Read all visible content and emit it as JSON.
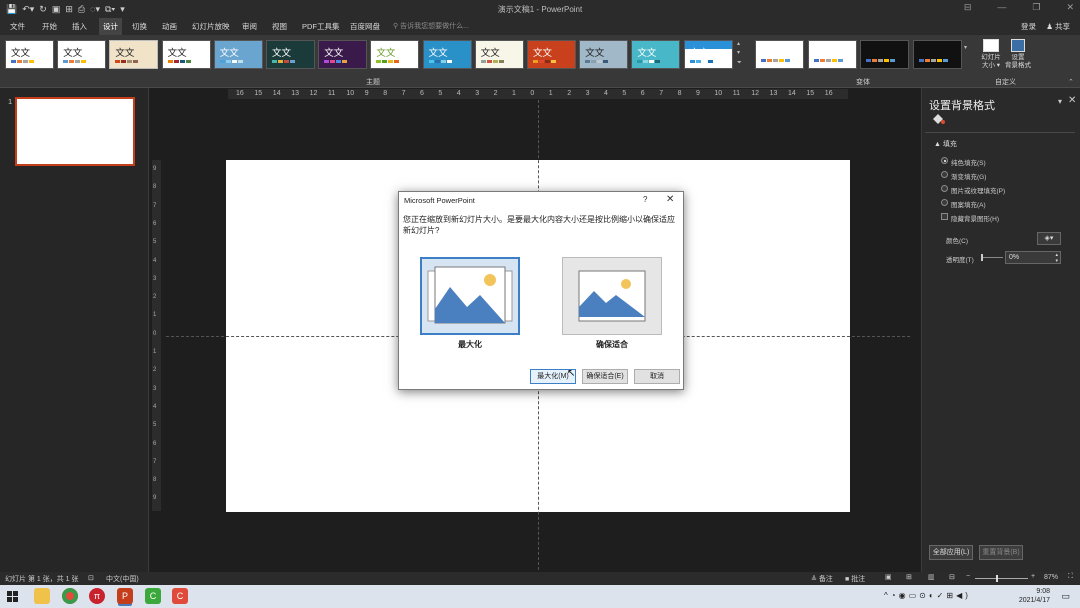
{
  "window": {
    "title": "演示文稿1 - PowerPoint"
  },
  "tabs": [
    "文件",
    "开始",
    "插入",
    "设计",
    "切换",
    "动画",
    "幻灯片放映",
    "审阅",
    "视图",
    "PDF工具集",
    "百度网盘"
  ],
  "active_tab": "设计",
  "tellme": "告诉我您想要做什么...",
  "account": {
    "login": "登录",
    "share": "共享"
  },
  "ribbon": {
    "themes_label": "主题",
    "variants_label": "变体",
    "custom_label": "自定义",
    "theme_thumb_text": "文文",
    "slide_size_label": "幻灯片\n大小 ▾",
    "format_bg_label": "设置\n背景格式"
  },
  "slide_number": "1",
  "ruler_h": [
    "16",
    "15",
    "14",
    "13",
    "12",
    "11",
    "10",
    "9",
    "8",
    "7",
    "6",
    "5",
    "4",
    "3",
    "2",
    "1",
    "0",
    "1",
    "2",
    "3",
    "4",
    "5",
    "6",
    "7",
    "8",
    "9",
    "10",
    "11",
    "12",
    "13",
    "14",
    "15",
    "16"
  ],
  "ruler_v": [
    "9",
    "8",
    "7",
    "6",
    "5",
    "4",
    "3",
    "2",
    "1",
    "0",
    "1",
    "2",
    "3",
    "4",
    "5",
    "6",
    "7",
    "8",
    "9"
  ],
  "dialog": {
    "title": "Microsoft PowerPoint",
    "help": "?",
    "close": "✕",
    "message": "您正在缩放到新幻灯片大小。是要最大化内容大小还是按比例缩小以确保适应新幻灯片?",
    "option_maximize": "最大化",
    "option_ensure_fit": "确保适合",
    "btn_maximize": "最大化(M)",
    "btn_ensure_fit": "确保适合(E)",
    "btn_cancel": "取消"
  },
  "format_pane": {
    "title": "设置背景格式",
    "fill_header": "▲ 填充",
    "options": [
      "纯色填充(S)",
      "渐变填充(G)",
      "图片或纹理填充(P)",
      "图案填充(A)"
    ],
    "selected_index": 0,
    "hide_bg_graphics": "隐藏背景图形(H)",
    "color_label": "颜色(C)",
    "transparency_label": "透明度(T)",
    "transparency_value": "0%",
    "apply_all": "全部应用(L)",
    "reset_bg": "重置背景(B)"
  },
  "status": {
    "slide_info": "幻灯片 第 1 张，共 1 张",
    "language": "中文(中国)",
    "notes": "备注",
    "comments": "批注",
    "zoom": "87%"
  },
  "taskbar": {
    "time": "9:08",
    "date": "2021/4/17"
  },
  "colors": {
    "accent": "#c43e1c",
    "dialog_highlight": "#3c7fc7",
    "mountain": "#4a80c0",
    "sun": "#f2c45a"
  }
}
